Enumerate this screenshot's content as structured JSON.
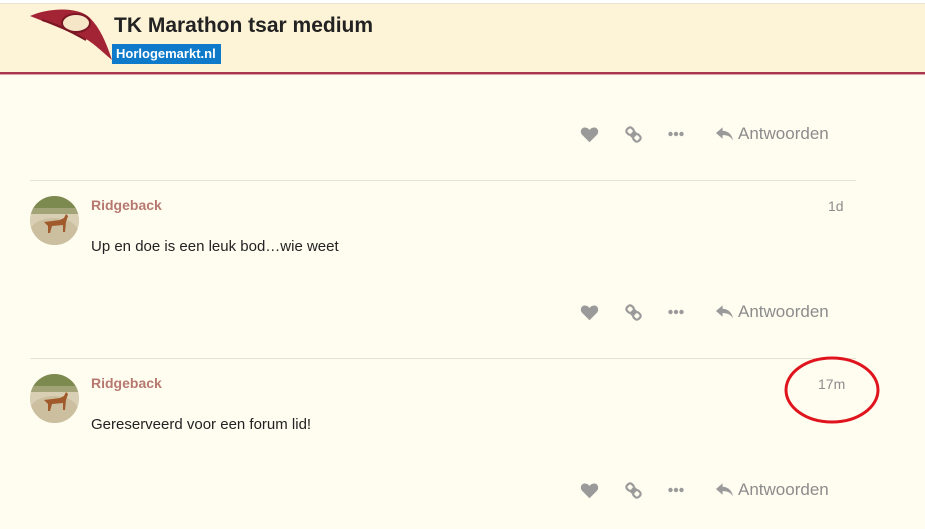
{
  "header": {
    "title": "TK Marathon tsar medium",
    "site_badge": "Horlogemarkt.nl"
  },
  "actions": {
    "like_icon": "heart-icon",
    "link_icon": "link-icon",
    "more_icon": "ellipsis-icon",
    "reply_icon": "reply-arrow-icon",
    "reply_label": "Antwoorden"
  },
  "posts": [
    {
      "username": "Ridgeback",
      "date": "1d",
      "body": "Up en doe is een leuk bod…wie weet"
    },
    {
      "username": "Ridgeback",
      "date": "17m",
      "body": "Gereserveerd voor een forum lid!"
    }
  ],
  "colors": {
    "header_bg": "#fdf3d6",
    "header_border": "#a8364c",
    "badge_bg": "#0f7ac9",
    "username": "#b7786f",
    "annotation": "#e0141e"
  }
}
